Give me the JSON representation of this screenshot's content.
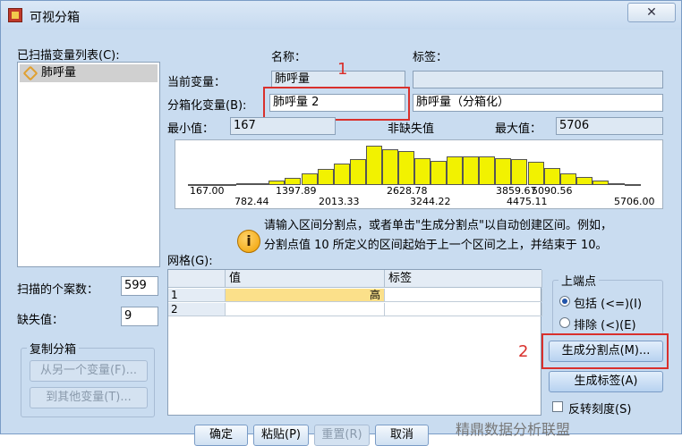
{
  "window": {
    "title": "可视分箱",
    "close_label": "✕"
  },
  "scanned_list": {
    "label": "已扫描变量列表(C):",
    "items": [
      "肺呼量"
    ]
  },
  "columns": {
    "name": "名称：",
    "label": "标签："
  },
  "current_var": {
    "label": "当前变量：",
    "name": "肺呼量",
    "tag": ""
  },
  "binned_var": {
    "label": "分箱化变量(B):",
    "name": "肺呼量 2",
    "tag": "肺呼量（分箱化）"
  },
  "stats": {
    "min_label": "最小值：",
    "min_value": "167",
    "nonmissing_label": "非缺失值",
    "max_label": "最大值：",
    "max_value": "5706"
  },
  "chart_data": {
    "type": "bar",
    "x_ticks_top": [
      "167.00",
      "1397.89",
      "2628.78",
      "3859.67",
      "5090.56"
    ],
    "x_ticks_bottom": [
      "782.44",
      "2013.33",
      "3244.22",
      "4475.11",
      "5706.00"
    ],
    "values": [
      1,
      1,
      1,
      2,
      3,
      6,
      10,
      16,
      22,
      30,
      36,
      55,
      50,
      47,
      38,
      34,
      40,
      40,
      40,
      38,
      36,
      32,
      24,
      16,
      11,
      6,
      3,
      1
    ],
    "xlim": [
      167,
      5706
    ]
  },
  "info": {
    "icon": "info-icon",
    "line1": "请输入区间分割点，或者单击\"生成分割点\"以自动创建区间。例如，",
    "line2": "分割点值 10 所定义的区间起始于上一个区间之上，并结束于 10。"
  },
  "grid": {
    "label": "网格(G):",
    "headers": [
      "值",
      "标签"
    ],
    "rows": [
      {
        "num": "1",
        "value": "",
        "value_suffix": "高",
        "tag": ""
      },
      {
        "num": "2",
        "value": "",
        "value_suffix": "",
        "tag": ""
      }
    ]
  },
  "counts": {
    "scanned_label": "扫描的个案数：",
    "scanned_value": "599",
    "missing_label": "缺失值：",
    "missing_value": "9"
  },
  "copy_bins": {
    "title": "复制分箱",
    "from_label": "从另一个变量(F)...",
    "to_label": "到其他变量(T)..."
  },
  "upper_end": {
    "title": "上端点",
    "include_label": "包括 (<=)(I)",
    "exclude_label": "排除 (<)(E)"
  },
  "actions": {
    "make_cutpoints": "生成分割点(M)...",
    "make_labels": "生成标签(A)",
    "reverse_label": "反转刻度(S)"
  },
  "annotations": {
    "n1": "1",
    "n2": "2"
  },
  "bottom_buttons": [
    "确定",
    "粘贴(P)",
    "重置(R)",
    "取消"
  ],
  "watermark": "精鼎数据分析联盟"
}
